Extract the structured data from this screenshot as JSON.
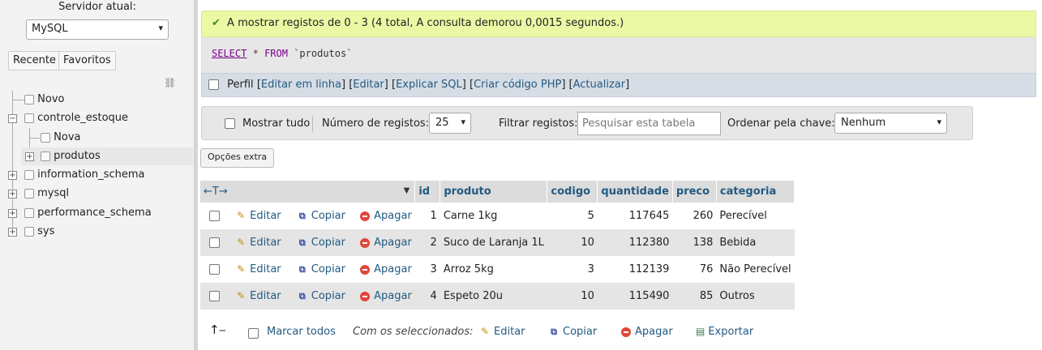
{
  "nav": {
    "server_label": "Servidor atual:",
    "server_value": "MySQL",
    "tab_recent": "Recente",
    "tab_favorites": "Favoritos",
    "tree": [
      {
        "label": "Novo"
      },
      {
        "label": "controle_estoque"
      },
      {
        "label": "Nova"
      },
      {
        "label": "produtos"
      },
      {
        "label": "information_schema"
      },
      {
        "label": "mysql"
      },
      {
        "label": "performance_schema"
      },
      {
        "label": "sys"
      }
    ]
  },
  "status": {
    "message": "A mostrar registos de 0 - 3 (4 total, A consulta demorou 0,0015 segundos.)"
  },
  "sql": {
    "kw_select": "SELECT",
    "star": "*",
    "kw_from": "FROM",
    "table": "`produtos`"
  },
  "sql_links": {
    "profile": "Perfil",
    "edit_inline": "Editar em linha",
    "edit": "Editar",
    "explain": "Explicar SQL",
    "php": "Criar código PHP",
    "refresh": "Actualizar"
  },
  "toolbar": {
    "show_all": "Mostrar tudo",
    "rows_label": "Número de registos:",
    "rows_value": "25",
    "filter_label": "Filtrar registos:",
    "filter_placeholder": "Pesquisar esta tabela",
    "sort_label": "Ordenar pela chave:",
    "sort_value": "Nenhum"
  },
  "extra_options": "Opções extra",
  "table": {
    "nav_arrows": "←T→",
    "columns": [
      "id",
      "produto",
      "codigo",
      "quantidade",
      "preco",
      "categoria"
    ],
    "actions": {
      "edit": "Editar",
      "copy": "Copiar",
      "delete": "Apagar"
    },
    "rows": [
      {
        "id": "1",
        "produto": "Carne 1kg",
        "codigo": "5",
        "quantidade": "117645",
        "preco": "260",
        "categoria": "Perecível"
      },
      {
        "id": "2",
        "produto": "Suco de Laranja 1L",
        "codigo": "10",
        "quantidade": "112380",
        "preco": "138",
        "categoria": "Bebida"
      },
      {
        "id": "3",
        "produto": "Arroz 5kg",
        "codigo": "3",
        "quantidade": "112139",
        "preco": "76",
        "categoria": "Não Perecível"
      },
      {
        "id": "4",
        "produto": "Espeto 20u",
        "codigo": "10",
        "quantidade": "115490",
        "preco": "85",
        "categoria": "Outros"
      }
    ]
  },
  "bottom": {
    "check_all": "Marcar todos",
    "with_selected": "Com os seleccionados:",
    "edit": "Editar",
    "copy": "Copiar",
    "delete": "Apagar",
    "export": "Exportar"
  }
}
